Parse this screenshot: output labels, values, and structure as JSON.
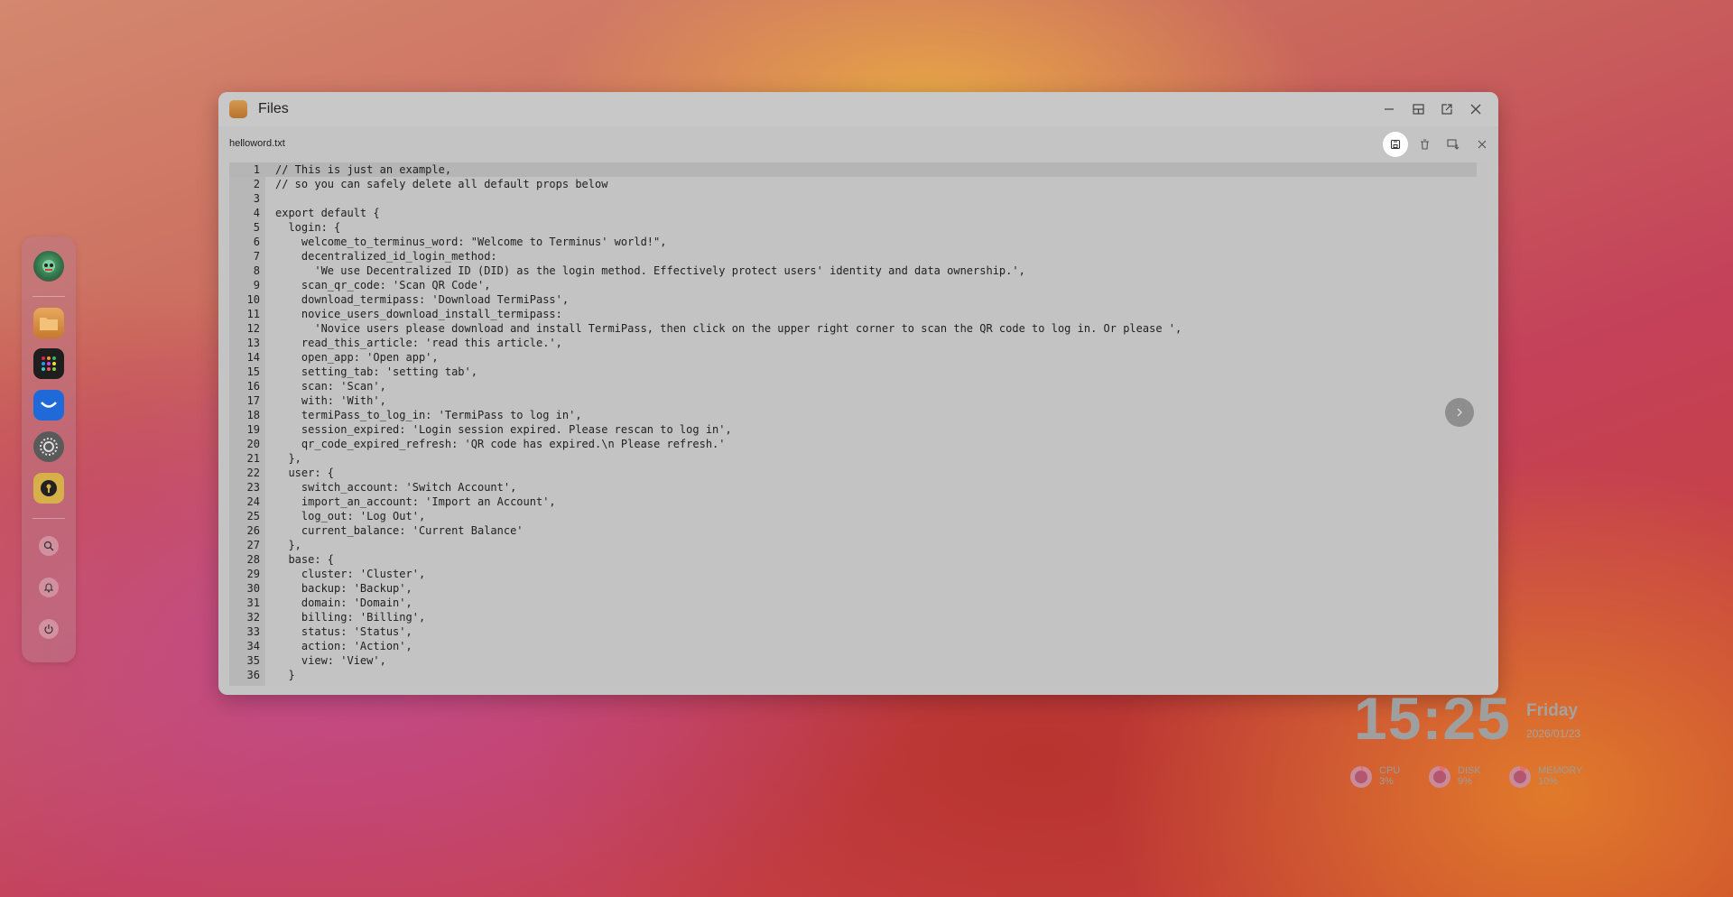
{
  "window": {
    "title": "Files",
    "file_name": "helloword.txt"
  },
  "code_lines": [
    {
      "n": "1",
      "text": "// This is just an example,"
    },
    {
      "n": "2",
      "text": "// so you can safely delete all default props below"
    },
    {
      "n": "3",
      "text": ""
    },
    {
      "n": "4",
      "text": "export default {"
    },
    {
      "n": "5",
      "text": "  login: {"
    },
    {
      "n": "6",
      "text": "    welcome_to_terminus_word: \"Welcome to Terminus' world!\","
    },
    {
      "n": "7",
      "text": "    decentralized_id_login_method:"
    },
    {
      "n": "8",
      "text": "      'We use Decentralized ID (DID) as the login method. Effectively protect users' identity and data ownership.',"
    },
    {
      "n": "9",
      "text": "    scan_qr_code: 'Scan QR Code',"
    },
    {
      "n": "10",
      "text": "    download_termipass: 'Download TermiPass',"
    },
    {
      "n": "11",
      "text": "    novice_users_download_install_termipass:"
    },
    {
      "n": "12",
      "text": "      'Novice users please download and install TermiPass, then click on the upper right corner to scan the QR code to log in. Or please ',"
    },
    {
      "n": "13",
      "text": "    read_this_article: 'read this article.',"
    },
    {
      "n": "14",
      "text": "    open_app: 'Open app',"
    },
    {
      "n": "15",
      "text": "    setting_tab: 'setting tab',"
    },
    {
      "n": "16",
      "text": "    scan: 'Scan',"
    },
    {
      "n": "17",
      "text": "    with: 'With',"
    },
    {
      "n": "18",
      "text": "    termiPass_to_log_in: 'TermiPass to log in',"
    },
    {
      "n": "19",
      "text": "    session_expired: 'Login session expired. Please rescan to log in',"
    },
    {
      "n": "20",
      "text": "    qr_code_expired_refresh: 'QR code has expired.\\n Please refresh.'"
    },
    {
      "n": "21",
      "text": "  },"
    },
    {
      "n": "22",
      "text": "  user: {"
    },
    {
      "n": "23",
      "text": "    switch_account: 'Switch Account',"
    },
    {
      "n": "24",
      "text": "    import_an_account: 'Import an Account',"
    },
    {
      "n": "25",
      "text": "    log_out: 'Log Out',"
    },
    {
      "n": "26",
      "text": "    current_balance: 'Current Balance'"
    },
    {
      "n": "27",
      "text": "  },"
    },
    {
      "n": "28",
      "text": "  base: {"
    },
    {
      "n": "29",
      "text": "    cluster: 'Cluster',"
    },
    {
      "n": "30",
      "text": "    backup: 'Backup',"
    },
    {
      "n": "31",
      "text": "    domain: 'Domain',"
    },
    {
      "n": "32",
      "text": "    billing: 'Billing',"
    },
    {
      "n": "33",
      "text": "    status: 'Status',"
    },
    {
      "n": "34",
      "text": "    action: 'Action',"
    },
    {
      "n": "35",
      "text": "    view: 'View',"
    },
    {
      "n": "36",
      "text": "  }"
    }
  ],
  "widget": {
    "time": "15:25",
    "day": "Friday",
    "date": "2026/01/23",
    "stats": [
      {
        "label": "CPU",
        "value": "3%",
        "fraction": 0.03
      },
      {
        "label": "DISK",
        "value": "9%",
        "fraction": 0.09
      },
      {
        "label": "MEMORY",
        "value": "10%",
        "fraction": 0.1
      }
    ]
  },
  "icons": {
    "window_controls": [
      "minimize-icon",
      "maximize-icon",
      "popout-icon",
      "close-icon"
    ],
    "file_toolbar": [
      "save-icon",
      "delete-icon",
      "download-icon",
      "close-icon"
    ],
    "dock": [
      "avatar",
      "files-app-icon",
      "launchpad-icon",
      "market-icon",
      "settings-icon",
      "vault-icon",
      "search-icon",
      "bell-icon",
      "power-icon"
    ]
  },
  "colors": {
    "ring_track": "#c98a9a",
    "ring_fill": "#e36f6f"
  }
}
